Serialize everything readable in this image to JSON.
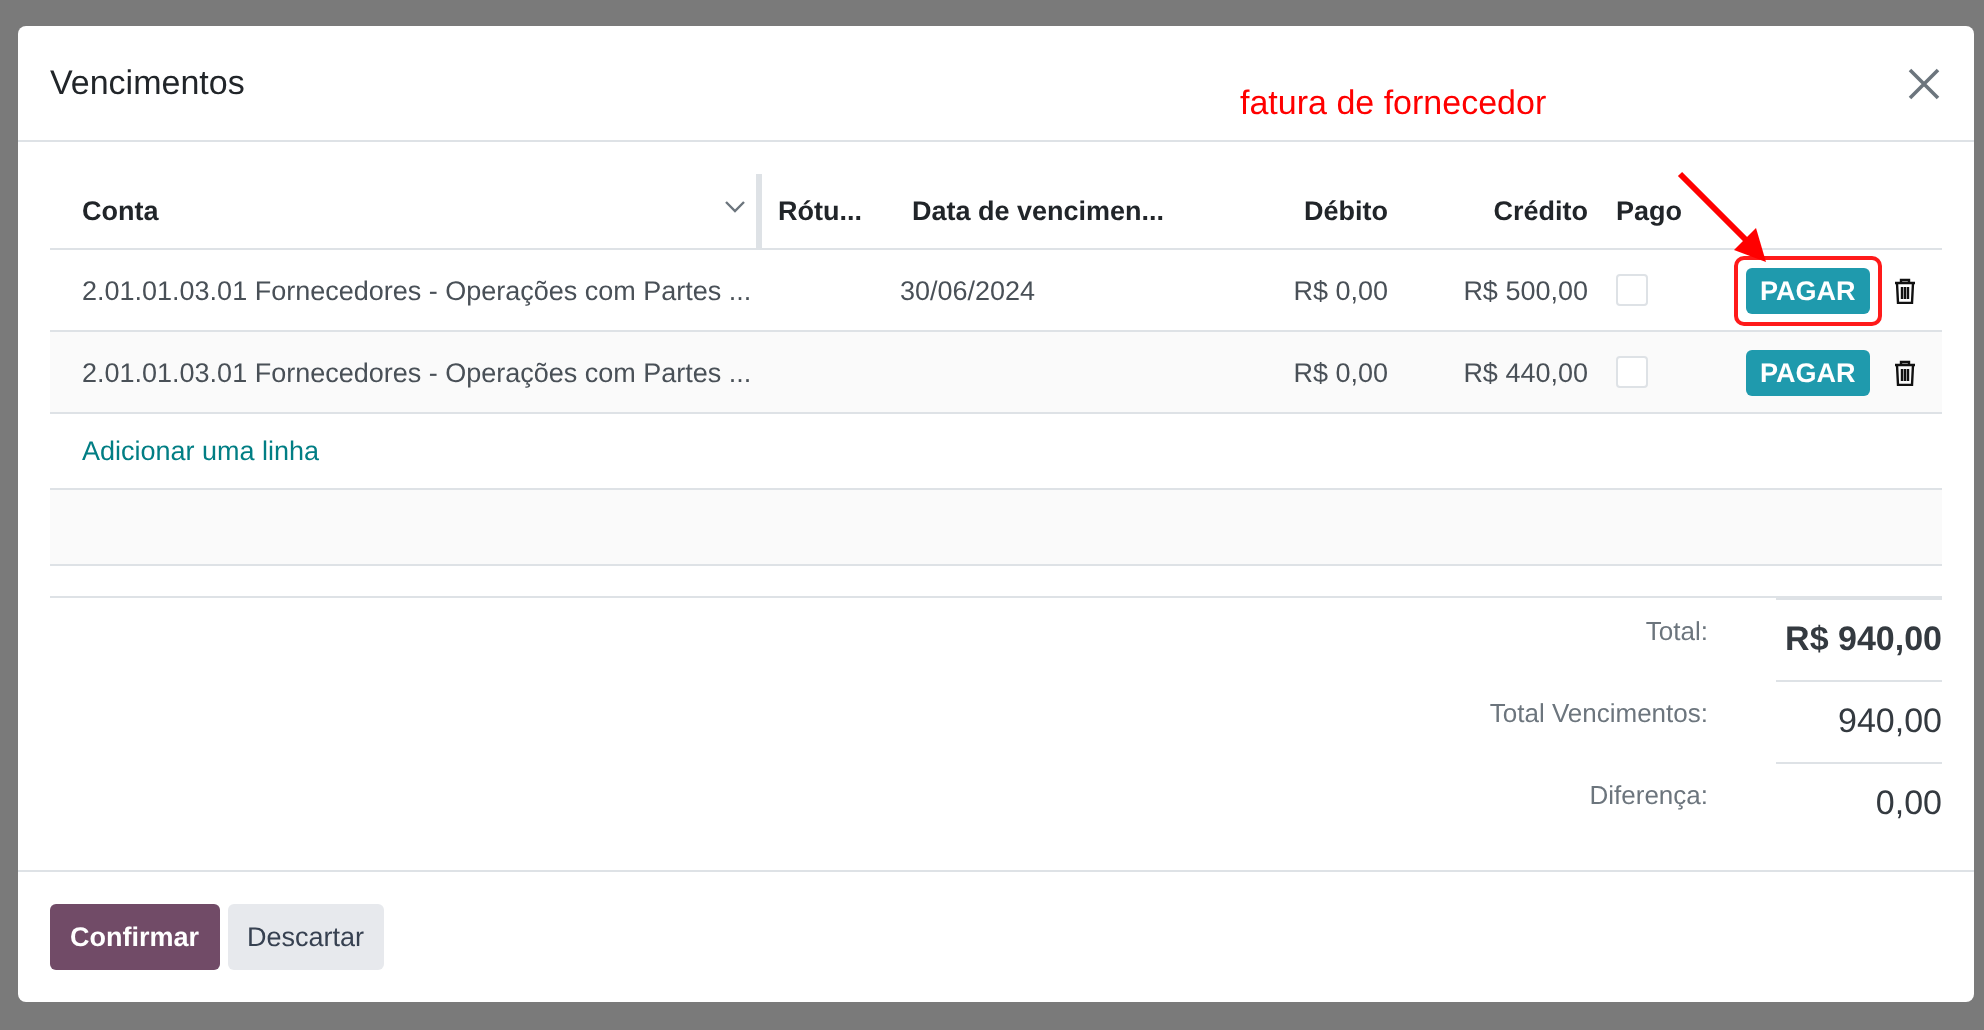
{
  "dialog": {
    "title": "Vencimentos"
  },
  "annotation": {
    "text": "fatura de fornecedor"
  },
  "table": {
    "columns": [
      "Conta",
      "Rótu...",
      "Data de vencimen...",
      "Débito",
      "Crédito",
      "Pago"
    ],
    "rows": [
      {
        "account": "2.01.01.03.01 Fornecedores - Operações com Partes ...",
        "due_date": "30/06/2024",
        "debit": "R$ 0,00",
        "credit": "R$ 500,00",
        "paid": false,
        "action": "PAGAR",
        "highlighted": true
      },
      {
        "account": "2.01.01.03.01 Fornecedores - Operações com Partes ...",
        "debit": "R$ 0,00",
        "credit": "R$ 440,00",
        "paid": false,
        "action": "PAGAR",
        "highlighted": false
      }
    ],
    "add_line": "Adicionar uma linha"
  },
  "totals": [
    {
      "label": "Total:",
      "value": "R$ 940,00"
    },
    {
      "label": "Total Vencimentos:",
      "value": "940,00"
    },
    {
      "label": "Diferença:",
      "value": "0,00"
    }
  ],
  "footer_buttons": [
    {
      "label": "Confirmar",
      "kind": "primary"
    },
    {
      "label": "Descartar",
      "kind": "secondary"
    }
  ]
}
